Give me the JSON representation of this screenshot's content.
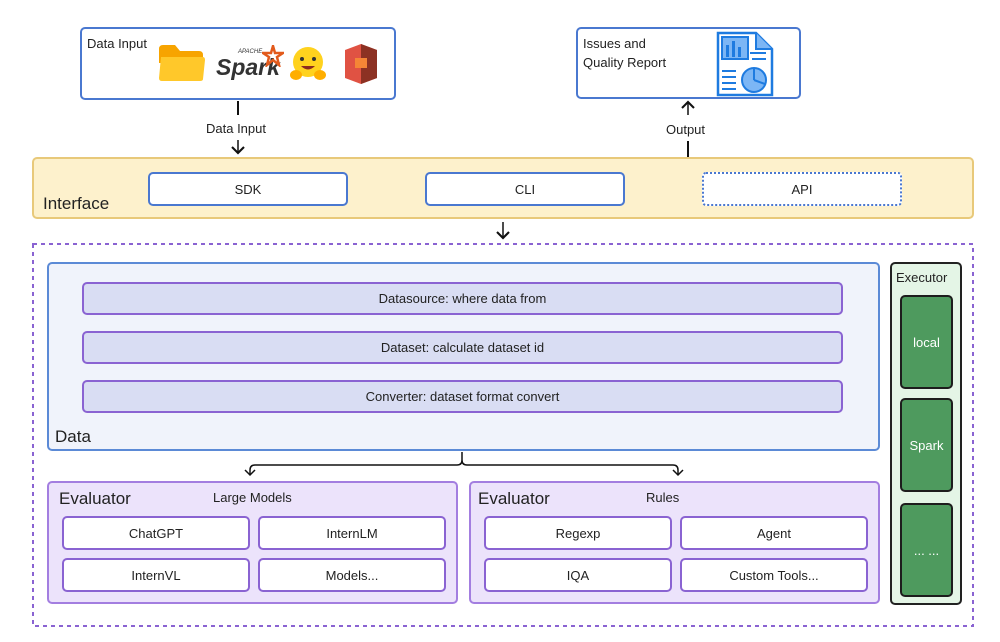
{
  "input_box": {
    "label": "Data Input",
    "icons": [
      "folder-icon",
      "apache-spark-logo",
      "hugging-face-icon",
      "aws-s3-icon"
    ],
    "spark_text": "Spark",
    "spark_apache": "APACHE"
  },
  "input_arrow_label": "Data Input",
  "report_box": {
    "line1": "Issues and",
    "line2": "Quality Report",
    "icon": "report-document-icon"
  },
  "output_arrow_label": "Output",
  "interface": {
    "title": "Interface",
    "items": [
      "SDK",
      "CLI",
      "API"
    ]
  },
  "data": {
    "title": "Data",
    "steps": [
      "Datasource: where data from",
      "Dataset: calculate dataset id",
      "Converter: dataset format convert"
    ]
  },
  "evaluators": [
    {
      "title": "Evaluator",
      "subtitle": "Large Models",
      "items": [
        "ChatGPT",
        "InternLM",
        "InternVL",
        "Models..."
      ]
    },
    {
      "title": "Evaluator",
      "subtitle": "Rules",
      "items": [
        "Regexp",
        "Agent",
        "IQA",
        "Custom Tools..."
      ]
    }
  ],
  "executor": {
    "title": "Executor",
    "items": [
      "local",
      "Spark",
      "... ..."
    ]
  },
  "colors": {
    "interface_bg": "#fdf1cc",
    "data_bg": "#f0f3fb",
    "evaluator_bg": "#ece3fb",
    "executor_bg": "#e4f5e6",
    "executor_item": "#4e9a5e",
    "accent_purple": "#8a63d2",
    "accent_blue": "#4a78d0"
  }
}
